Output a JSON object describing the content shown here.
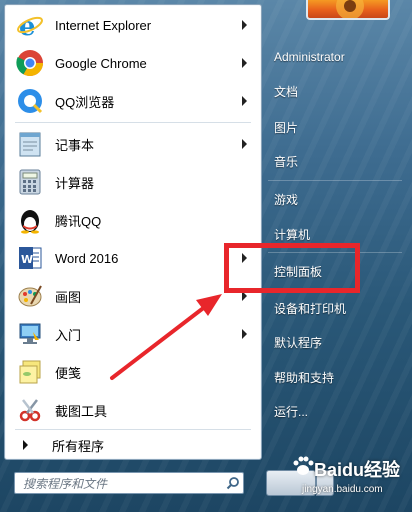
{
  "programs": [
    {
      "label": "Internet Explorer",
      "icon": "internet-explorer-icon",
      "has_submenu": true
    },
    {
      "label": "Google Chrome",
      "icon": "chrome-icon",
      "has_submenu": true
    },
    {
      "label": "QQ浏览器",
      "icon": "qq-browser-icon",
      "has_submenu": true
    },
    {
      "label": "记事本",
      "icon": "notepad-icon",
      "has_submenu": true
    },
    {
      "label": "计算器",
      "icon": "calculator-icon",
      "has_submenu": false
    },
    {
      "label": "腾讯QQ",
      "icon": "qq-penguin-icon",
      "has_submenu": false
    },
    {
      "label": "Word 2016",
      "icon": "word-icon",
      "has_submenu": true
    },
    {
      "label": "画图",
      "icon": "paint-icon",
      "has_submenu": true
    },
    {
      "label": "入门",
      "icon": "getting-started-icon",
      "has_submenu": true
    },
    {
      "label": "便笺",
      "icon": "sticky-notes-icon",
      "has_submenu": false
    },
    {
      "label": "截图工具",
      "icon": "snipping-tool-icon",
      "has_submenu": false
    }
  ],
  "all_programs_label": "所有程序",
  "search": {
    "placeholder": "搜索程序和文件"
  },
  "right_pane": [
    "Administrator",
    "文档",
    "图片",
    "音乐",
    "游戏",
    "计算机",
    "控制面板",
    "设备和打印机",
    "默认程序",
    "帮助和支持",
    "运行..."
  ],
  "watermark": {
    "brand": "Baidu经验",
    "url": "jingyan.baidu.com"
  },
  "colors": {
    "annotation_red": "#e8262b",
    "menu_glass": "#3e6c90"
  }
}
